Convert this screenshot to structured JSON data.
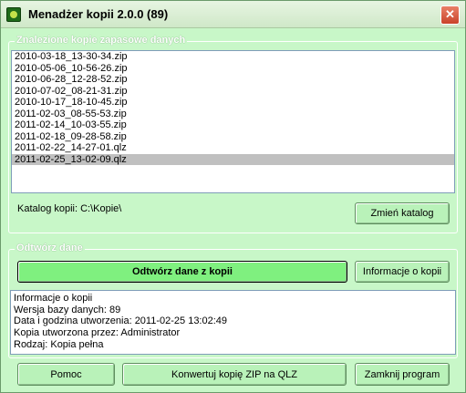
{
  "window": {
    "title": "Menadżer kopii  2.0.0 (89)",
    "close_symbol": "✕"
  },
  "backups_group": {
    "legend": "Znalezione kopie zapasowe danych",
    "files": [
      "2010-03-18_13-30-34.zip",
      "2010-05-06_10-56-26.zip",
      "2010-06-28_12-28-52.zip",
      "2010-07-02_08-21-31.zip",
      "2010-10-17_18-10-45.zip",
      "2011-02-03_08-55-53.zip",
      "2011-02-14_10-03-55.zip",
      "2011-02-18_09-28-58.zip",
      "2011-02-22_14-27-01.qlz",
      "2011-02-25_13-02-09.qlz"
    ],
    "selected_index": 9,
    "catalog_label": "Katalog kopii: C:\\Kopie\\",
    "change_catalog_button": "Zmień katalog"
  },
  "restore_group": {
    "legend": "Odtwórz dane",
    "restore_button": "Odtwórz dane z kopii",
    "info_button": "Informacje o kopii",
    "info_lines": [
      "Informacje o kopii",
      "Wersja bazy danych:  89",
      "Data i godzina utworzenia:  2011-02-25 13:02:49",
      "Kopia utworzona przez:  Administrator",
      "Rodzaj:  Kopia pełna"
    ]
  },
  "footer": {
    "help_button": "Pomoc",
    "convert_button": "Konwertuj kopię ZIP na QLZ",
    "close_button": "Zamknij program"
  }
}
